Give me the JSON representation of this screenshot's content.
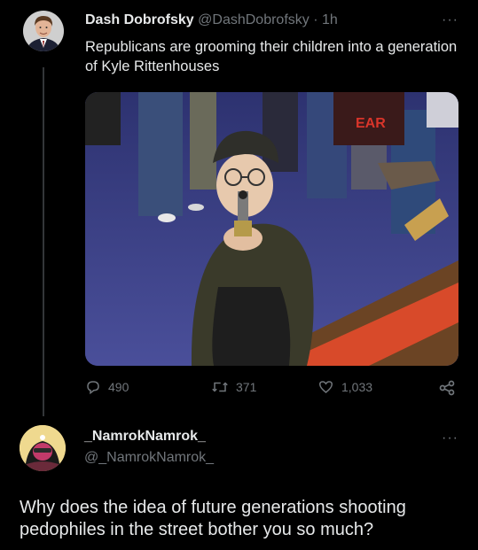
{
  "tweet": {
    "author_name": "Dash Dobrofsky",
    "author_handle": "@DashDobrofsky",
    "separator": "·",
    "time": "1h",
    "more_label": "···",
    "text": "Republicans are grooming their children into a generation of Kyle Rittenhouses",
    "photo_sign_text": "EAR",
    "actions": {
      "replies": "490",
      "retweets": "371",
      "likes": "1,033"
    }
  },
  "reply": {
    "author_name": "_NamrokNamrok_",
    "author_handle": "@_NamrokNamrok_",
    "more_label": "···",
    "text": "Why does the idea of future generations shooting pedophiles in the street bother you so much?"
  },
  "colors": {
    "background": "#000000",
    "text_primary": "#e7e9ea",
    "text_secondary": "#71767b",
    "thread_line": "#333639"
  },
  "icons": [
    "reply-icon",
    "retweet-icon",
    "like-icon",
    "share-icon",
    "more-icon"
  ]
}
